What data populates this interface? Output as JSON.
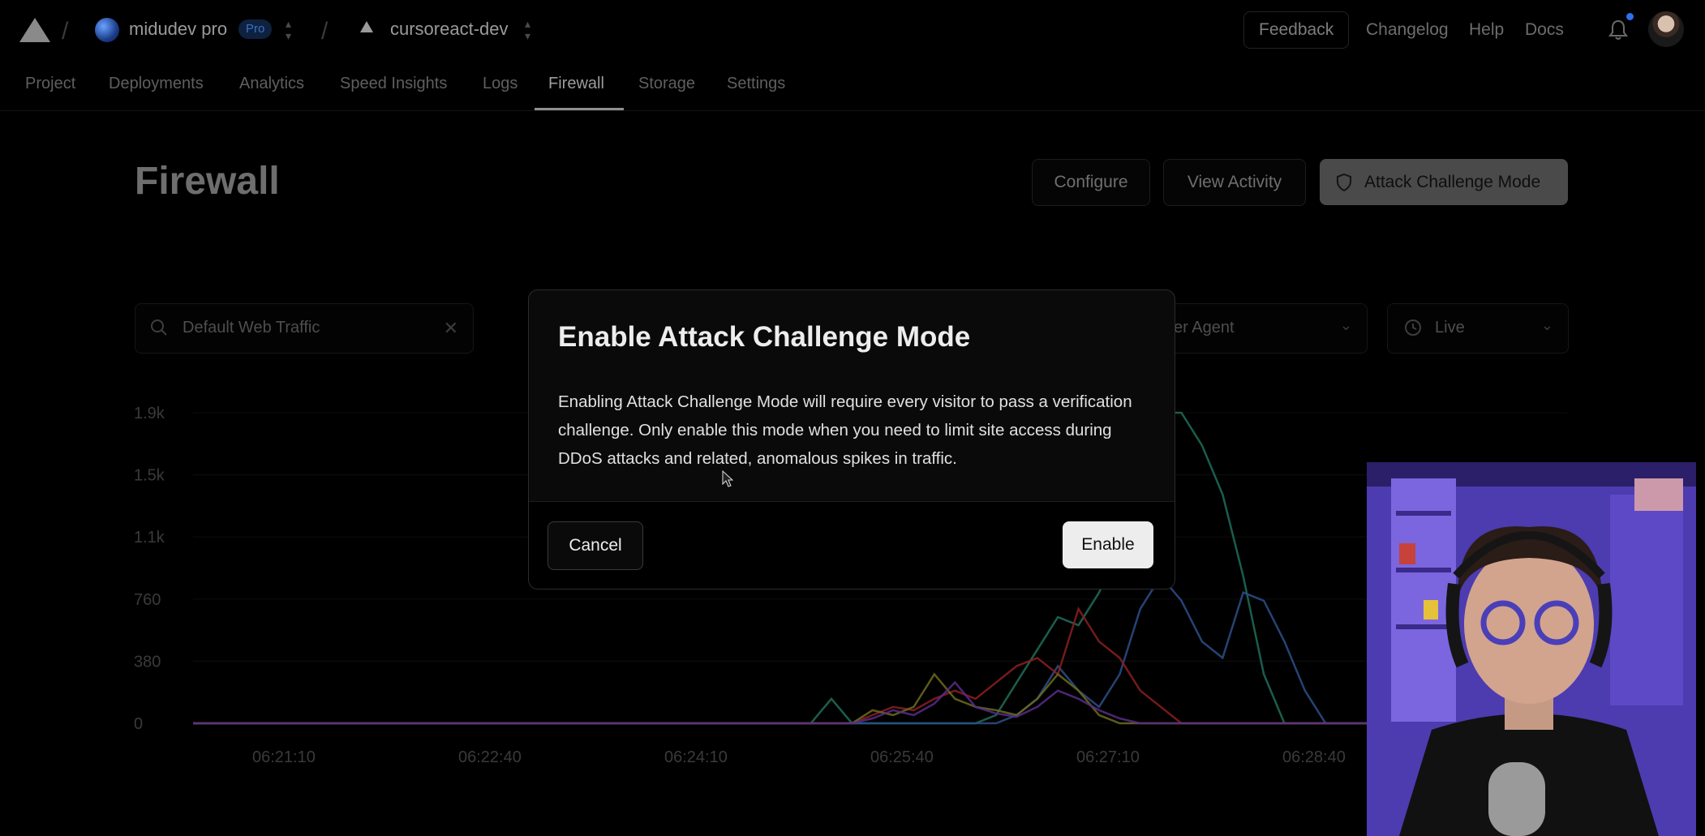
{
  "topbar": {
    "team_name": "midudev pro",
    "team_badge": "Pro",
    "project_name": "cursoreact-dev",
    "feedback": "Feedback",
    "links": [
      "Changelog",
      "Help",
      "Docs"
    ]
  },
  "nav": {
    "tabs": [
      "Project",
      "Deployments",
      "Analytics",
      "Speed Insights",
      "Logs",
      "Firewall",
      "Storage",
      "Settings"
    ],
    "active": "Firewall"
  },
  "page": {
    "title": "Firewall",
    "configure": "Configure",
    "view_activity": "View Activity",
    "attack_mode": "Attack Challenge Mode"
  },
  "filters": {
    "search_value": "Default Web Traffic",
    "group_by": "er Agent",
    "range": "Live"
  },
  "chart_data": {
    "type": "line",
    "y_ticks": [
      "1.9k",
      "1.5k",
      "1.1k",
      "760",
      "380",
      "0"
    ],
    "x_ticks": [
      "06:21:10",
      "06:22:40",
      "06:24:10",
      "06:25:40",
      "06:27:10",
      "06:28:40"
    ],
    "ylim": [
      0,
      1900
    ],
    "series": [
      {
        "color": "#1f6f5a",
        "values": [
          0,
          0,
          0,
          0,
          0,
          0,
          0,
          0,
          0,
          0,
          0,
          0,
          0,
          0,
          0,
          0,
          0,
          0,
          0,
          0,
          0,
          0,
          0,
          0,
          0,
          0,
          0,
          0,
          0,
          0,
          0,
          150,
          0,
          0,
          0,
          0,
          0,
          0,
          0,
          50,
          250,
          450,
          650,
          600,
          800,
          1100,
          1600,
          1900,
          1900,
          1700,
          1400,
          900,
          300,
          0,
          0,
          0,
          0,
          0
        ]
      },
      {
        "color": "#2b4f8a",
        "values": [
          0,
          0,
          0,
          0,
          0,
          0,
          0,
          0,
          0,
          0,
          0,
          0,
          0,
          0,
          0,
          0,
          0,
          0,
          0,
          0,
          0,
          0,
          0,
          0,
          0,
          0,
          0,
          0,
          0,
          0,
          0,
          0,
          0,
          0,
          0,
          0,
          0,
          0,
          0,
          0,
          50,
          150,
          350,
          200,
          100,
          300,
          700,
          900,
          750,
          500,
          400,
          800,
          750,
          500,
          200,
          0,
          0,
          0
        ]
      },
      {
        "color": "#8a1f1f",
        "values": [
          0,
          0,
          0,
          0,
          0,
          0,
          0,
          0,
          0,
          0,
          0,
          0,
          0,
          0,
          0,
          0,
          0,
          0,
          0,
          0,
          0,
          0,
          0,
          0,
          0,
          0,
          0,
          0,
          0,
          0,
          0,
          0,
          0,
          50,
          100,
          80,
          150,
          200,
          150,
          250,
          350,
          400,
          300,
          700,
          500,
          400,
          200,
          100,
          0,
          0,
          0,
          0,
          0,
          0,
          0,
          0,
          0,
          0
        ]
      },
      {
        "color": "#6b6b1f",
        "values": [
          0,
          0,
          0,
          0,
          0,
          0,
          0,
          0,
          0,
          0,
          0,
          0,
          0,
          0,
          0,
          0,
          0,
          0,
          0,
          0,
          0,
          0,
          0,
          0,
          0,
          0,
          0,
          0,
          0,
          0,
          0,
          0,
          0,
          80,
          50,
          100,
          300,
          150,
          100,
          80,
          50,
          150,
          300,
          200,
          50,
          0,
          0,
          0,
          0,
          0,
          0,
          0,
          0,
          0,
          0,
          0,
          0,
          0
        ]
      },
      {
        "color": "#5a2b8a",
        "values": [
          0,
          0,
          0,
          0,
          0,
          0,
          0,
          0,
          0,
          0,
          0,
          0,
          0,
          0,
          0,
          0,
          0,
          0,
          0,
          0,
          0,
          0,
          0,
          0,
          0,
          0,
          0,
          0,
          0,
          0,
          0,
          0,
          0,
          30,
          80,
          50,
          120,
          250,
          100,
          60,
          40,
          100,
          200,
          150,
          80,
          30,
          0,
          0,
          0,
          0,
          0,
          0,
          0,
          0,
          0,
          0,
          0,
          0
        ]
      }
    ]
  },
  "modal": {
    "title": "Enable Attack Challenge Mode",
    "body": "Enabling Attack Challenge Mode will require every visitor to pass a verification challenge. Only enable this mode when you need to limit site access during DDoS attacks and related, anomalous spikes in traffic.",
    "cancel": "Cancel",
    "enable": "Enable"
  }
}
